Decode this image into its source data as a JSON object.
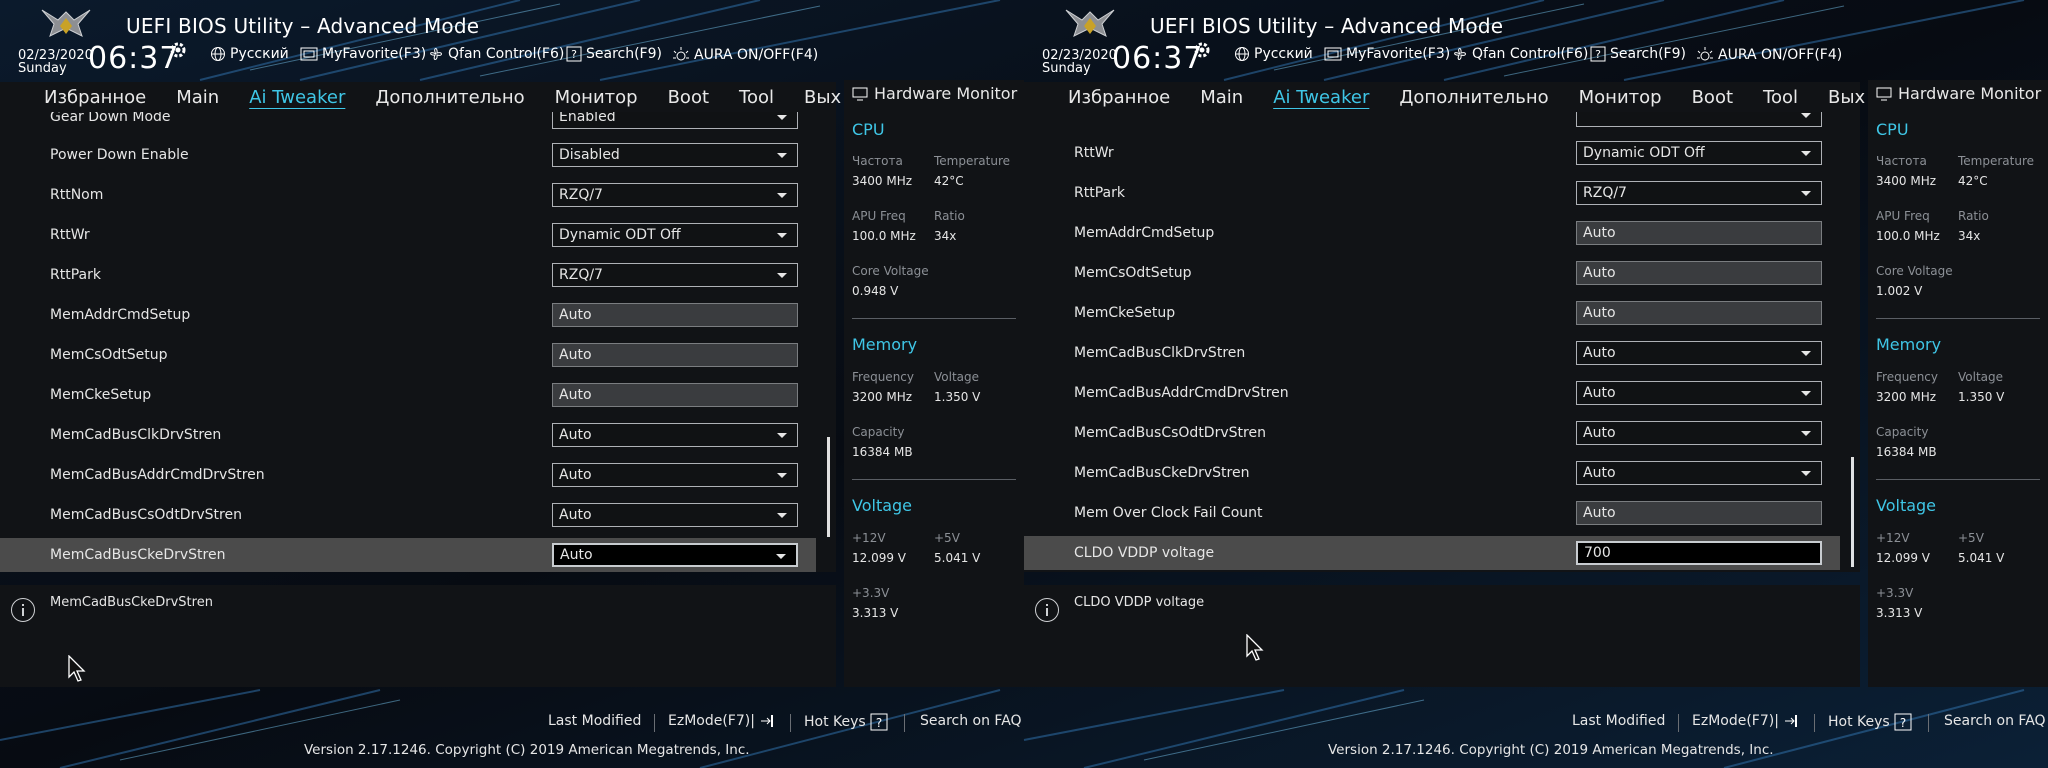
{
  "header": {
    "title": "UEFI BIOS Utility – Advanced Mode",
    "date": "02/23/2020",
    "day": "Sunday",
    "time": "06:37",
    "toolbar": [
      {
        "label": "Русский",
        "icon": "globe-icon"
      },
      {
        "label": "MyFavorite(F3)",
        "icon": "favorite-icon"
      },
      {
        "label": "Qfan Control(F6)",
        "icon": "fan-icon"
      },
      {
        "label": "Search(F9)",
        "icon": "search-icon"
      },
      {
        "label": "AURA ON/OFF(F4)",
        "icon": "aura-icon"
      }
    ]
  },
  "nav": {
    "tabs": [
      {
        "label": "Избранное"
      },
      {
        "label": "Main"
      },
      {
        "label": "Ai Tweaker"
      },
      {
        "label": "Дополнительно"
      },
      {
        "label": "Монитор"
      },
      {
        "label": "Boot"
      },
      {
        "label": "Tool"
      },
      {
        "label": "Вых"
      }
    ],
    "active": "Ai Tweaker"
  },
  "left_screen": {
    "rows": [
      {
        "label": "Gear Down Mode",
        "value": "Enabled",
        "type": "dropdown"
      },
      {
        "label": "Power Down Enable",
        "value": "Disabled",
        "type": "dropdown"
      },
      {
        "label": "RttNom",
        "value": "RZQ/7",
        "type": "dropdown"
      },
      {
        "label": "RttWr",
        "value": "Dynamic ODT Off",
        "type": "dropdown"
      },
      {
        "label": "RttPark",
        "value": "RZQ/7",
        "type": "dropdown"
      },
      {
        "label": "MemAddrCmdSetup",
        "value": "Auto",
        "type": "static"
      },
      {
        "label": "MemCsOdtSetup",
        "value": "Auto",
        "type": "static"
      },
      {
        "label": "MemCkeSetup",
        "value": "Auto",
        "type": "static"
      },
      {
        "label": "MemCadBusClkDrvStren",
        "value": "Auto",
        "type": "dropdown"
      },
      {
        "label": "MemCadBusAddrCmdDrvStren",
        "value": "Auto",
        "type": "dropdown"
      },
      {
        "label": "MemCadBusCsOdtDrvStren",
        "value": "Auto",
        "type": "dropdown"
      },
      {
        "label": "MemCadBusCkeDrvStren",
        "value": "Auto",
        "type": "dropdown",
        "selected": true
      }
    ],
    "help_text": "MemCadBusCkeDrvStren",
    "hw": {
      "cpu_freq": "3400 MHz",
      "cpu_temp": "42°C",
      "apu_freq": "100.0 MHz",
      "ratio": "34x",
      "core_voltage": "0.948 V"
    }
  },
  "right_screen": {
    "rows": [
      {
        "label": "",
        "value": "",
        "type": "dropdown"
      },
      {
        "label": "RttWr",
        "value": "Dynamic ODT Off",
        "type": "dropdown"
      },
      {
        "label": "RttPark",
        "value": "RZQ/7",
        "type": "dropdown"
      },
      {
        "label": "MemAddrCmdSetup",
        "value": "Auto",
        "type": "static"
      },
      {
        "label": "MemCsOdtSetup",
        "value": "Auto",
        "type": "static"
      },
      {
        "label": "MemCkeSetup",
        "value": "Auto",
        "type": "static"
      },
      {
        "label": "MemCadBusClkDrvStren",
        "value": "Auto",
        "type": "dropdown"
      },
      {
        "label": "MemCadBusAddrCmdDrvStren",
        "value": "Auto",
        "type": "dropdown"
      },
      {
        "label": "MemCadBusCsOdtDrvStren",
        "value": "Auto",
        "type": "dropdown"
      },
      {
        "label": "MemCadBusCkeDrvStren",
        "value": "Auto",
        "type": "dropdown"
      },
      {
        "label": "Mem Over Clock Fail Count",
        "value": "Auto",
        "type": "static"
      },
      {
        "label": "CLDO VDDP voltage",
        "value": "700",
        "type": "input",
        "selected": true
      }
    ],
    "help_text": "CLDO VDDP voltage",
    "hw": {
      "cpu_freq": "3400 MHz",
      "cpu_temp": "42°C",
      "apu_freq": "100.0 MHz",
      "ratio": "34x",
      "core_voltage": "1.002 V"
    }
  },
  "hw_monitor": {
    "title": "Hardware Monitor",
    "cpu_label": "CPU",
    "freq_label": "Частота",
    "temp_label": "Temperature",
    "apu_label": "APU Freq",
    "ratio_label": "Ratio",
    "core_voltage_label": "Core Voltage",
    "memory_label": "Memory",
    "mem_freq_label": "Frequency",
    "mem_voltage_label": "Voltage",
    "mem_freq": "3200 MHz",
    "mem_voltage": "1.350 V",
    "capacity_label": "Capacity",
    "capacity": "16384 MB",
    "voltage_label": "Voltage",
    "v12_label": "+12V",
    "v12": "12.099 V",
    "v5_label": "+5V",
    "v5": "5.041 V",
    "v33_label": "+3.3V",
    "v33": "3.313 V"
  },
  "footer": {
    "last_modified": "Last Modified",
    "ezmode": "EzMode(F7)|",
    "hotkeys": "Hot Keys",
    "search_faq": "Search on FAQ",
    "version": "Version 2.17.1246. Copyright (C) 2019 American Megatrends, Inc."
  },
  "colors": {
    "accent": "#3fc6e6",
    "panel": "#111316",
    "selected_row": "#4b4b4b"
  },
  "scrollbar": {
    "left_position": 0.85,
    "right_position": 0.95
  }
}
